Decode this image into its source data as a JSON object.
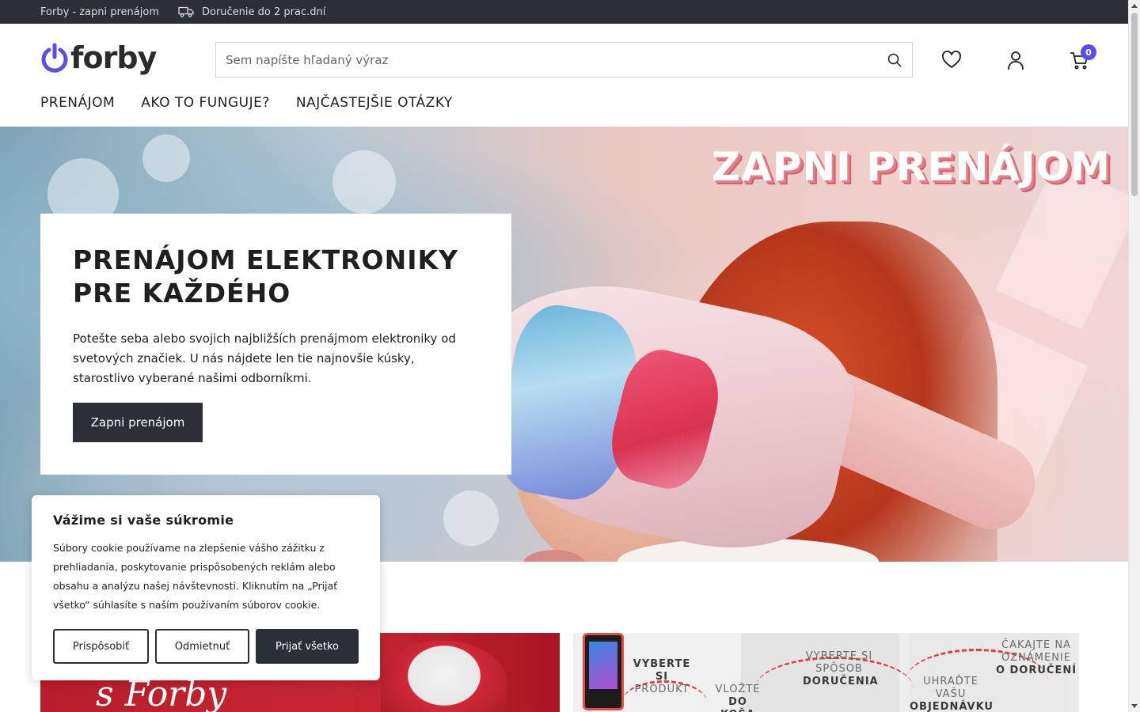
{
  "topbar": {
    "brand_text": "Forby - zapni prenájom",
    "delivery_text": "Doručenie do 2 prac.dní",
    "delivery_icon": "truck-icon"
  },
  "header": {
    "logo_text": "forby",
    "logo_icon": "power-icon",
    "search_placeholder": "Sem napíšte hľadaný výraz",
    "cart_count": "0",
    "icons": [
      "search-icon",
      "heart-icon",
      "user-icon",
      "cart-icon"
    ]
  },
  "nav": {
    "items": [
      "PRENÁJOM",
      "AKO TO FUNGUJE?",
      "NAJČASTEJŠIE OTÁZKY"
    ]
  },
  "hero": {
    "overlay_title": "ZAPNI PRENÁJOM",
    "heading_line1": "PRENÁJOM ELEKTRONIKY",
    "heading_line2": "PRE KAŽDÉHO",
    "description": "Potešte seba alebo svojich najbližších prenájmom elektroniky od svetových značiek. U nás nájdete len tie najnovšie kúsky, starostlivo vyberané našimi odborníkmi.",
    "cta_label": "Zapni prenájom"
  },
  "banners": {
    "left_script_text": "s Forby",
    "steps": [
      {
        "light": "VYBERTE SI",
        "bold": "PRODUKT"
      },
      {
        "light": "VLOŽTE",
        "bold": "DO KOŠA"
      },
      {
        "light": "VYBERTE SI SPÔSOB",
        "bold": "DORUČENIA"
      },
      {
        "light": "UHRAĎTE VAŠU",
        "bold": "OBJEDNÁVKU"
      },
      {
        "light": "ČAKAJTE NA OZNÁMENIE",
        "bold": "O DORUČENÍ"
      }
    ]
  },
  "cookie": {
    "title": "Vážime si vaše súkromie",
    "text": "Súbory cookie používame na zlepšenie vášho zážitku z prehliadania, poskytovanie prispôsobených reklám alebo obsahu a analýzu našej návštevnosti. Kliknutím na „Prijať všetko“ súhlasíte s naším používaním súborov cookie.",
    "customize_label": "Prispôsobiť",
    "reject_label": "Odmietnuť",
    "accept_label": "Prijať všetko"
  },
  "colors": {
    "accent": "#5b4ee6",
    "dark": "#2b2f36"
  }
}
